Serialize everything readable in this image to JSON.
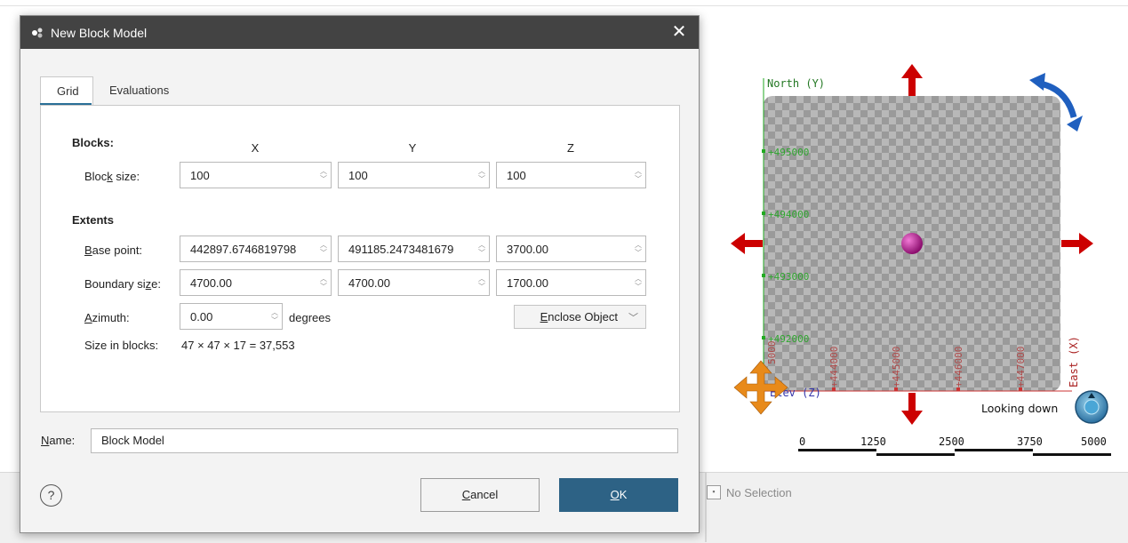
{
  "dialog": {
    "title": "New Block Model",
    "close_glyph": "✕",
    "tabs": [
      {
        "label": "Grid",
        "active": true
      },
      {
        "label": "Evaluations",
        "active": false
      }
    ],
    "blocks": {
      "heading": "Blocks:",
      "columns": [
        "X",
        "Y",
        "Z"
      ],
      "block_size_label_pre": "Bloc",
      "block_size_label_ul": "k",
      "block_size_label_post": " size:",
      "block_size": [
        "100",
        "100",
        "100"
      ]
    },
    "extents": {
      "heading": "Extents",
      "base_point_label_ul": "B",
      "base_point_label_post": "ase point:",
      "base_point": [
        "442897.6746819798",
        "491185.2473481679",
        "3700.00"
      ],
      "boundary_label_pre": "Boundary si",
      "boundary_label_ul": "z",
      "boundary_label_post": "e:",
      "boundary_size": [
        "4700.00",
        "4700.00",
        "1700.00"
      ],
      "azimuth_label_ul": "A",
      "azimuth_label_post": "zimuth:",
      "azimuth": "0.00",
      "azimuth_unit": "degrees",
      "enclose_label_ul": "E",
      "enclose_label_post": "nclose Object",
      "size_in_blocks_label": "Size in blocks:",
      "size_in_blocks_value": "47 × 47 × 17 = 37,553"
    },
    "name": {
      "label_ul": "N",
      "label_post": "ame:",
      "value": "Block Model"
    },
    "help_glyph": "?",
    "cancel_ul": "C",
    "cancel_post": "ancel",
    "ok_ul": "O",
    "ok_post": "K"
  },
  "viewer": {
    "north_label": "North (Y)",
    "east_label": "East (X)",
    "elev_label": "Elev (Z)",
    "y_ticks": [
      "+495000",
      "+494000",
      "+493000",
      "+492000"
    ],
    "x_ticks": [
      "+444000",
      "+445000",
      "+446000",
      "+447000"
    ],
    "corner_tick": "5000",
    "view_label": "Looking down",
    "scale_labels": [
      "0",
      "1250",
      "2500",
      "3750",
      "5000"
    ],
    "arrow_color": "#cc0000",
    "rotate_color": "#1f5fbf",
    "move_color": "#e88a1a",
    "sphere_color": "#c2189b",
    "tick_color": "#22aa22"
  },
  "status": {
    "selection": "No Selection"
  }
}
